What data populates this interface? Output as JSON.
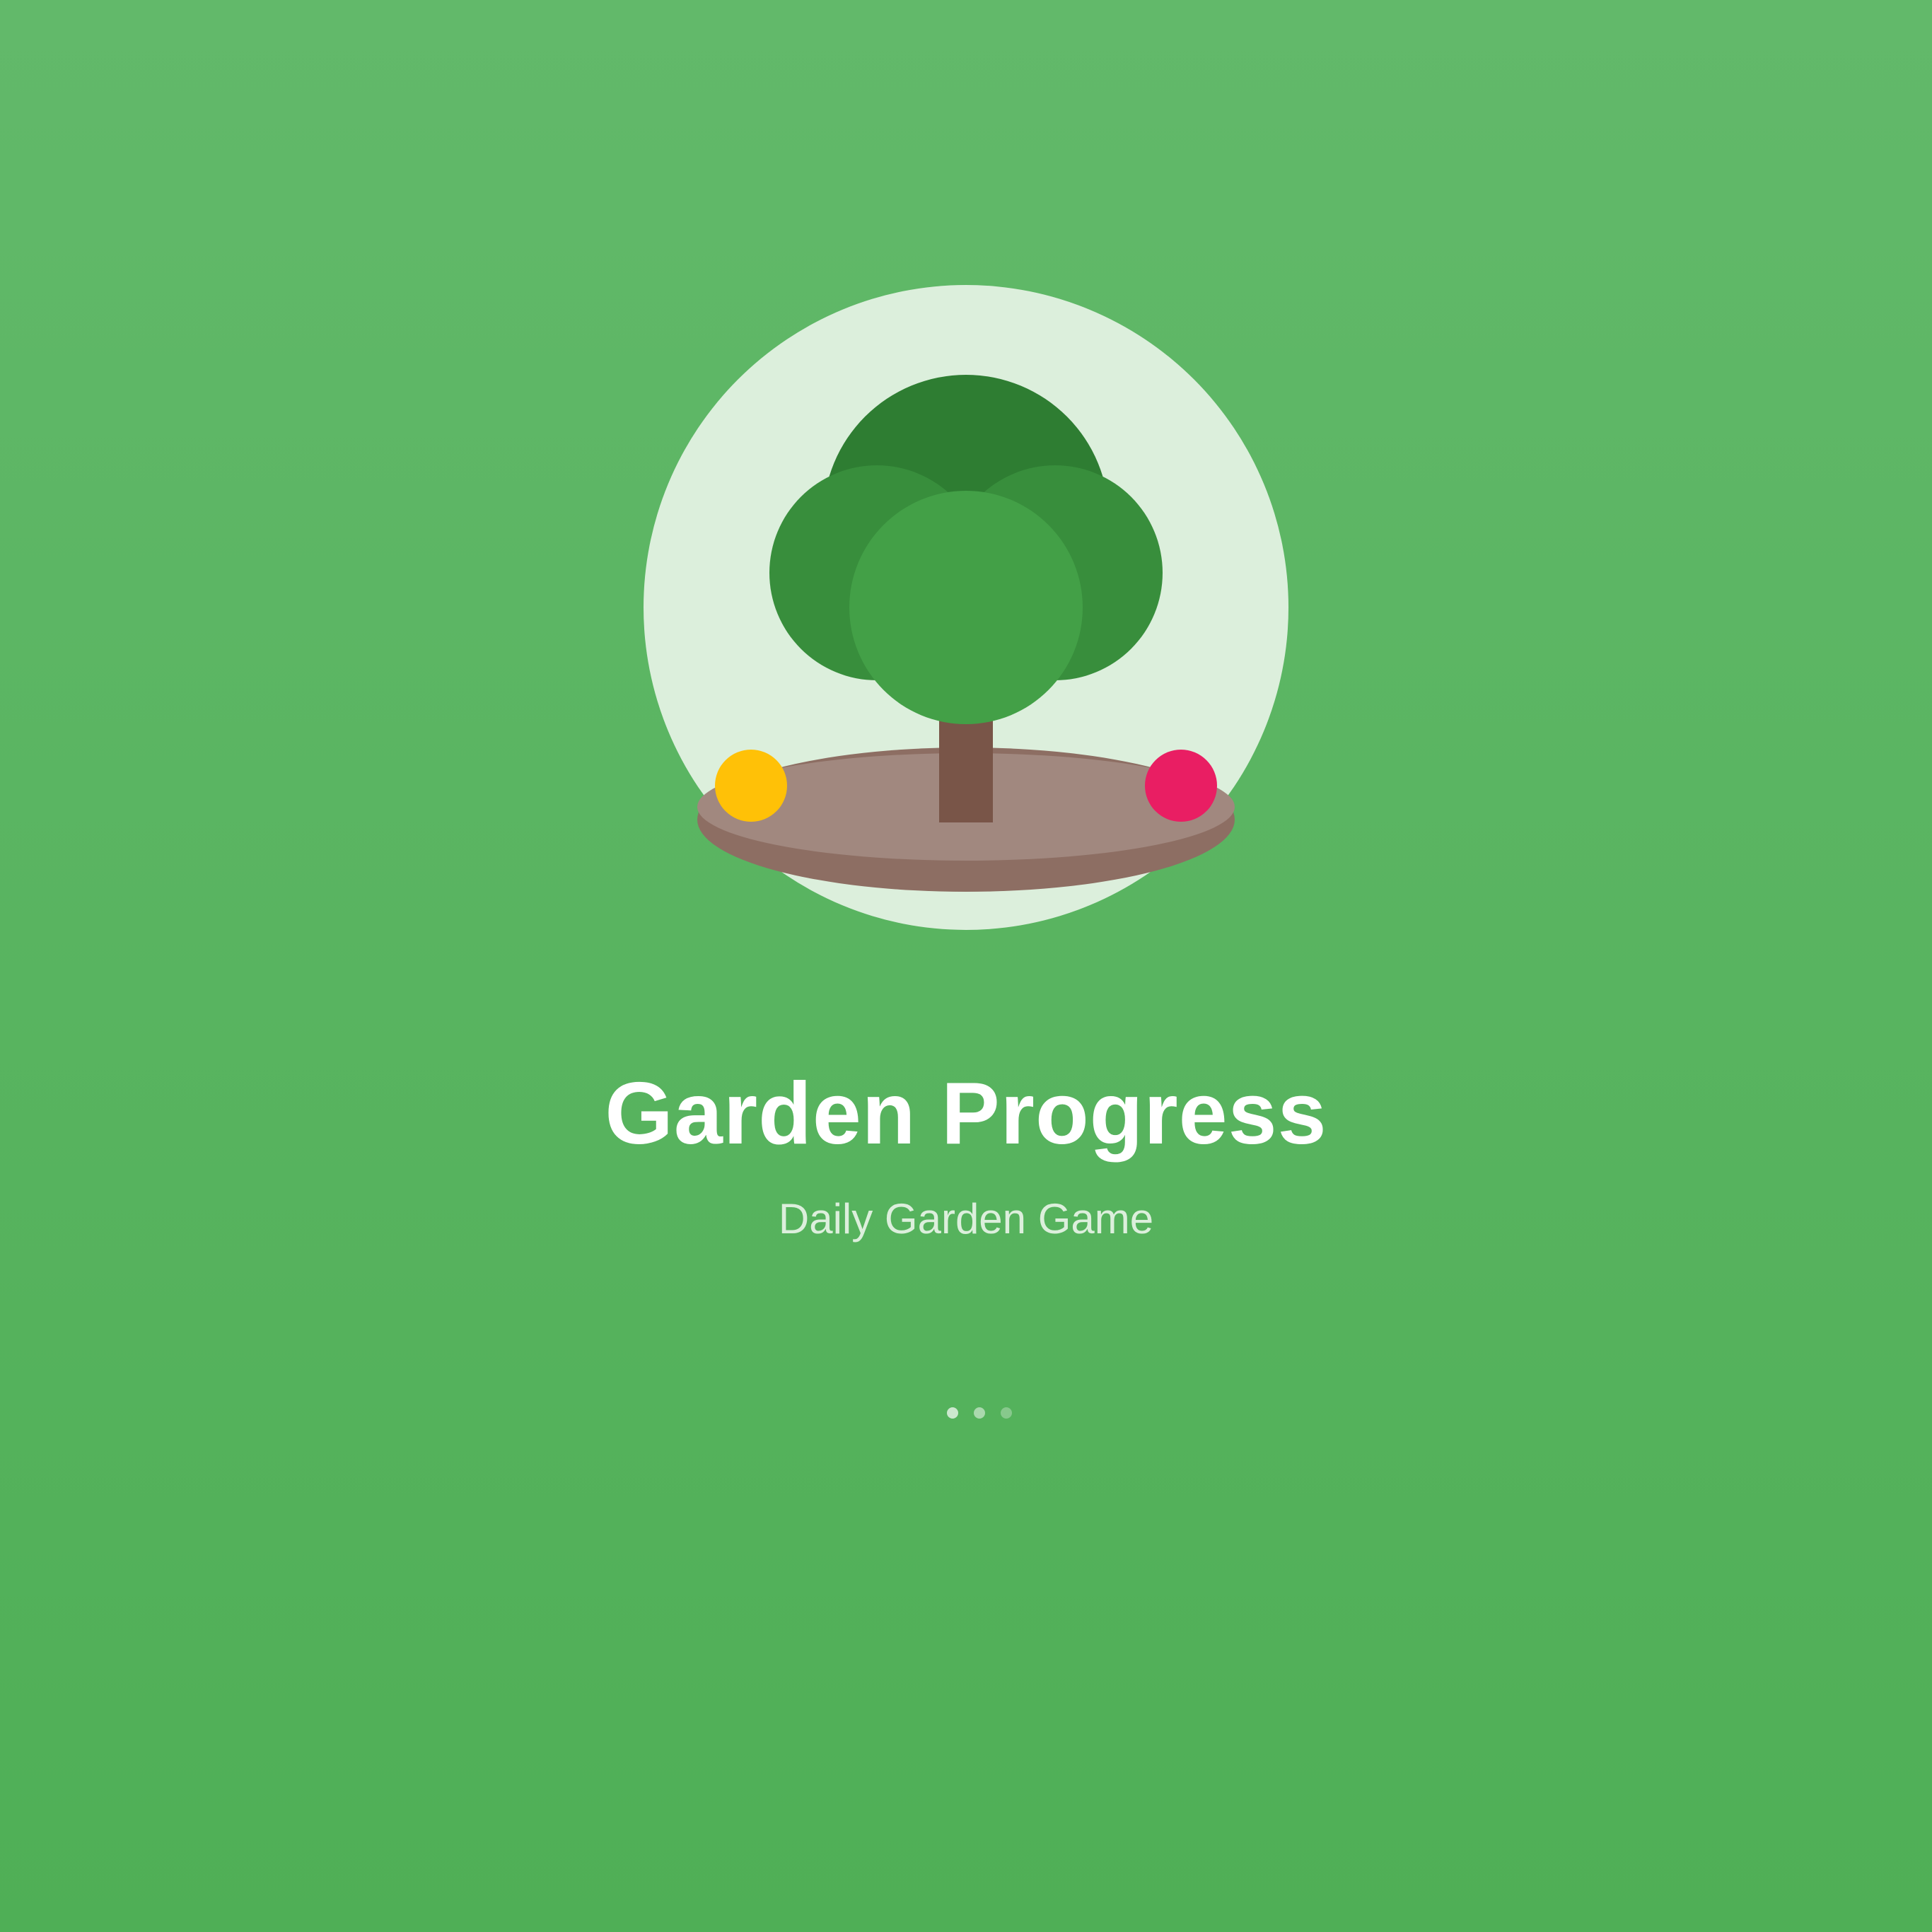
{
  "splash": {
    "title": "Garden Progress",
    "subtitle": "Daily Garden Game",
    "loading_indicator": {
      "dot_count": 3
    }
  },
  "illustration": {
    "icon": "tree-in-garden-icon",
    "elements": [
      "tree-icon",
      "yellow-flower-icon",
      "pink-flower-icon",
      "soil-platform"
    ]
  },
  "colors": {
    "background_top": "#62b96a",
    "background_bottom": "#4faf56",
    "badge_circle": "#dcefdc",
    "tree_canopy_dark": "#2e7d32",
    "tree_canopy_mid": "#388e3c",
    "tree_canopy_light": "#43a047",
    "trunk": "#795548",
    "soil_top": "#a1887f",
    "soil_side": "#8d6e63",
    "flower_yellow": "#ffc107",
    "flower_pink": "#e91e63",
    "title_text": "#ffffff",
    "subtitle_text": "#dcefdc"
  }
}
